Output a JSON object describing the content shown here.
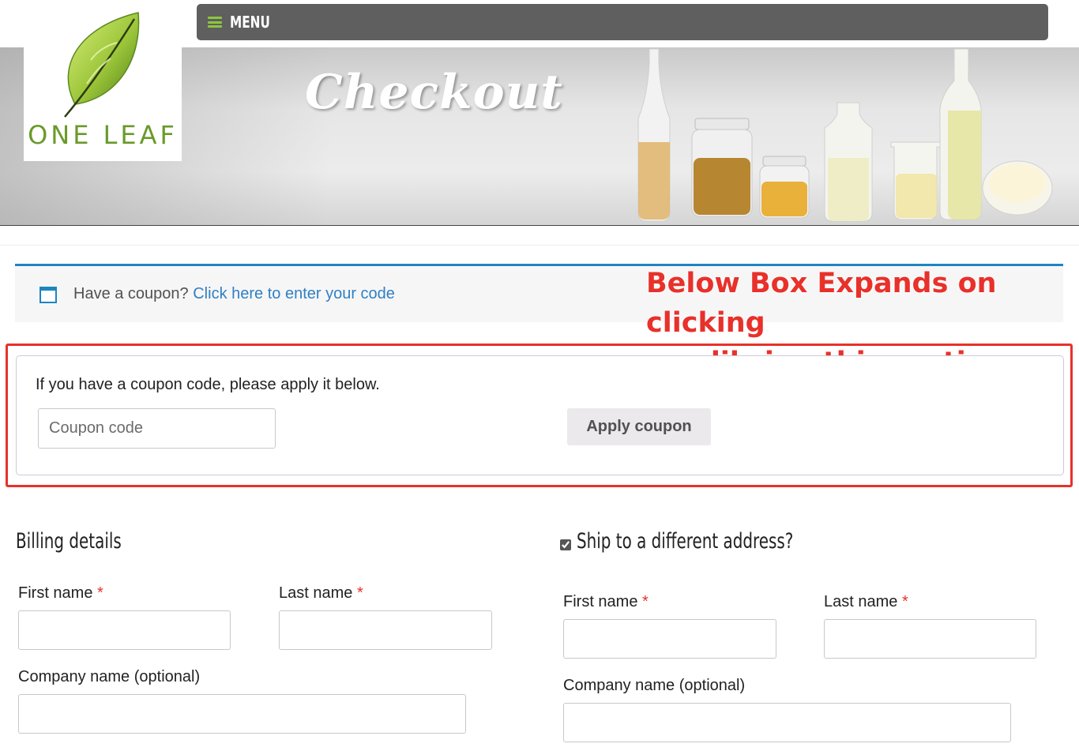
{
  "nav": {
    "menu_label": "MENU"
  },
  "logo": {
    "text": "ONE LEAF"
  },
  "banner": {
    "title": "Checkout"
  },
  "coupon_notice": {
    "prompt": "Have a coupon?",
    "link": "Click here to enter your code"
  },
  "annotation": {
    "line1": "Below Box Expands on clicking",
    "line2": "on clikcing this section"
  },
  "coupon_form": {
    "instructions": "If you have a coupon code, please apply it below.",
    "input_placeholder": "Coupon code",
    "input_value": "",
    "apply_label": "Apply coupon"
  },
  "billing": {
    "heading": "Billing details",
    "first_name_label": "First name",
    "last_name_label": "Last name",
    "company_label": "Company name (optional)",
    "required_mark": "*"
  },
  "shipping": {
    "heading": "Ship to a different address?",
    "checked": true,
    "first_name_label": "First name",
    "last_name_label": "Last name",
    "company_label": "Company name (optional)",
    "required_mark": "*"
  },
  "colors": {
    "accent_blue": "#1e85be",
    "link_blue": "#2f80c4",
    "annotation_red": "#e8312a",
    "menu_icon_green": "#8dc63f",
    "nav_bg": "#5f5f5f"
  },
  "icons": [
    "hamburger-menu-icon",
    "leaf-logo-icon",
    "calendar-icon",
    "checkbox-checked-icon"
  ]
}
